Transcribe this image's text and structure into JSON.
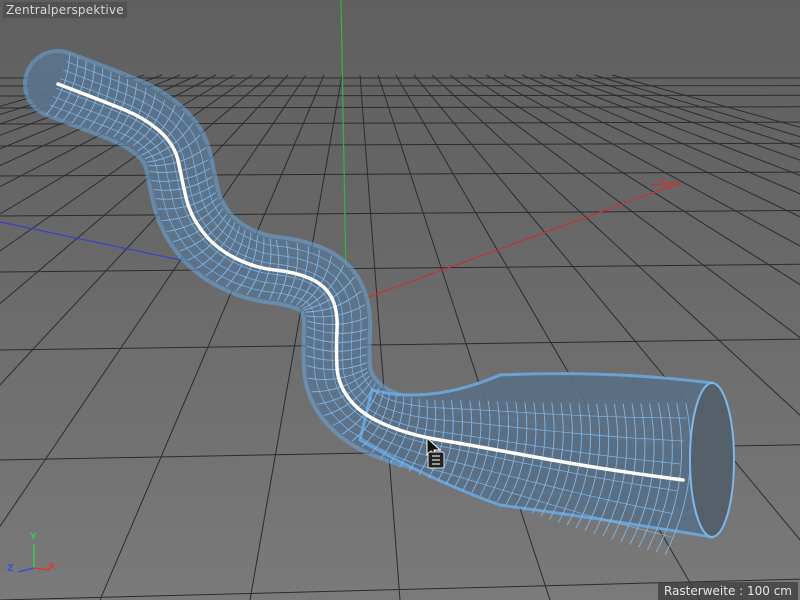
{
  "viewport": {
    "title": "Zentralperspektive",
    "grid_spacing_label": "Rasterweite : 100 cm"
  },
  "axis_gizmo": {
    "x_label": "X",
    "y_label": "Y",
    "z_label": "Z",
    "x_color": "#d43c3c",
    "y_color": "#3cc84a",
    "z_color": "#3a4fd8"
  },
  "scene_objects": {
    "tube_color": "#6aa8e0",
    "spline_color": "#ffffff",
    "grid_color": "#2c2c2c"
  },
  "cursor": {
    "icon": "move-cursor-icon"
  }
}
